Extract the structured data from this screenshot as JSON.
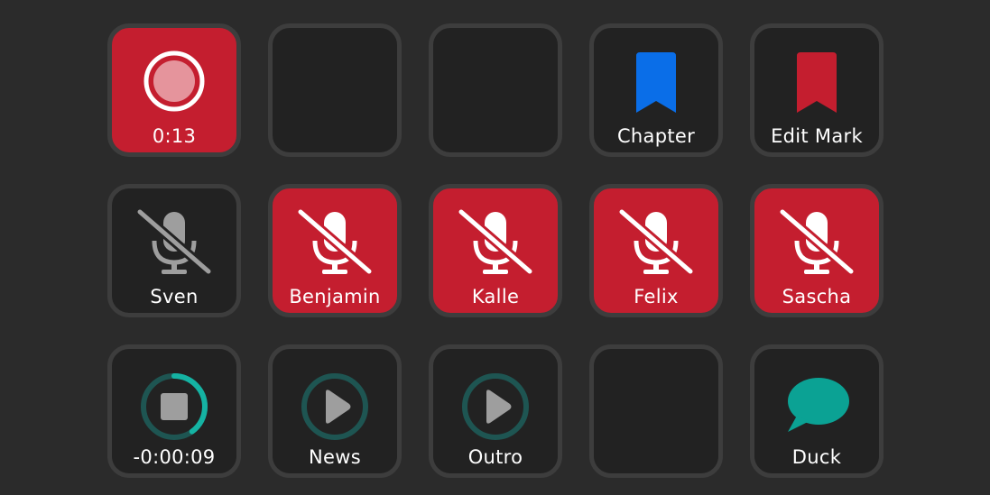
{
  "keys": {
    "record": {
      "label": "0:13",
      "icon": "record-icon",
      "color": "#c41e2f"
    },
    "chapter": {
      "label": "Chapter",
      "icon": "bookmark-icon",
      "color": "#0a6ee8"
    },
    "edit_mark": {
      "label": "Edit Mark",
      "icon": "bookmark-icon",
      "color": "#c41e2f"
    },
    "sven": {
      "label": "Sven",
      "icon": "mic-muted-icon",
      "state": "muted-off"
    },
    "benjamin": {
      "label": "Benjamin",
      "icon": "mic-muted-icon",
      "state": "muted"
    },
    "kalle": {
      "label": "Kalle",
      "icon": "mic-muted-icon",
      "state": "muted"
    },
    "felix": {
      "label": "Felix",
      "icon": "mic-muted-icon",
      "state": "muted"
    },
    "sascha": {
      "label": "Sascha",
      "icon": "mic-muted-icon",
      "state": "muted"
    },
    "stop": {
      "label": "-0:00:09",
      "icon": "stop-icon",
      "progress": 0.4
    },
    "news": {
      "label": "News",
      "icon": "play-icon"
    },
    "outro": {
      "label": "Outro",
      "icon": "play-icon"
    },
    "duck": {
      "label": "Duck",
      "icon": "chat-bubble-icon",
      "color": "#0ba294"
    }
  },
  "colors": {
    "accent_red": "#c41e2f",
    "teal": "#15b3a3"
  }
}
